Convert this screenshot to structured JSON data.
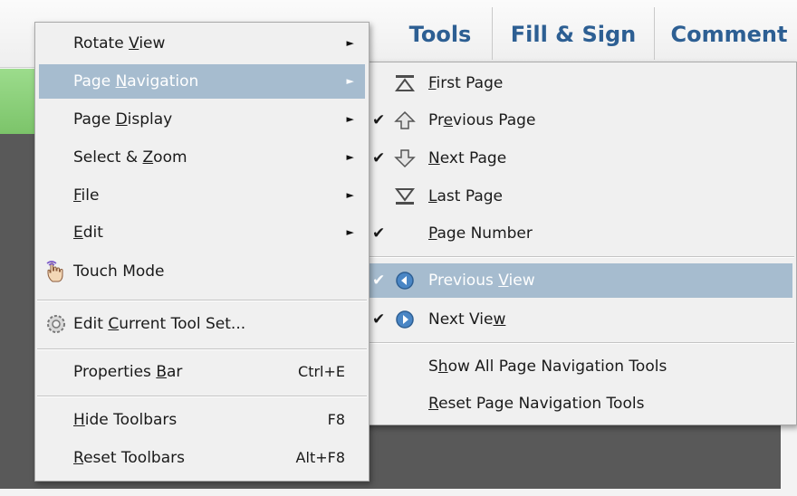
{
  "toolbar": {
    "tools": "Tools",
    "fill_sign": "Fill & Sign",
    "comment": "Comment"
  },
  "main_menu": {
    "rotate_view": {
      "pre": "Rotate ",
      "u": "V",
      "post": "iew"
    },
    "page_navigation": {
      "pre": "Page ",
      "u": "N",
      "post": "avigation"
    },
    "page_display": {
      "pre": "Page ",
      "u": "D",
      "post": "isplay"
    },
    "select_zoom": {
      "pre": "Select & ",
      "u": "Z",
      "post": "oom"
    },
    "file": {
      "pre": "",
      "u": "F",
      "post": "ile"
    },
    "edit": {
      "pre": "",
      "u": "E",
      "post": "dit"
    },
    "touch_mode": {
      "pre": "Touch Mode",
      "u": "",
      "post": ""
    },
    "edit_tool_set": {
      "pre": "Edit ",
      "u": "C",
      "post": "urrent Tool Set..."
    },
    "properties_bar": {
      "pre": "Properties ",
      "u": "B",
      "post": "ar",
      "shortcut": "Ctrl+E"
    },
    "hide_toolbars": {
      "pre": "",
      "u": "H",
      "post": "ide Toolbars",
      "shortcut": "F8"
    },
    "reset_toolbars": {
      "pre": "",
      "u": "R",
      "post": "eset Toolbars",
      "shortcut": "Alt+F8"
    }
  },
  "sub_menu": {
    "first_page": {
      "pre": "",
      "u": "F",
      "post": "irst Page",
      "checked": false,
      "icon": "first-page-icon"
    },
    "previous_page": {
      "pre": "Pr",
      "u": "e",
      "post": "vious Page",
      "checked": true,
      "icon": "up-arrow-icon"
    },
    "next_page": {
      "pre": "",
      "u": "N",
      "post": "ext Page",
      "checked": true,
      "icon": "down-arrow-icon"
    },
    "last_page": {
      "pre": "",
      "u": "L",
      "post": "ast Page",
      "checked": false,
      "icon": "last-page-icon"
    },
    "page_number": {
      "pre": "",
      "u": "P",
      "post": "age Number",
      "checked": true
    },
    "previous_view": {
      "pre": "Previous ",
      "u": "V",
      "post": "iew",
      "checked": true,
      "icon": "back-circle-icon"
    },
    "next_view": {
      "pre": "Next Vie",
      "u": "w",
      "post": "",
      "checked": true,
      "icon": "forward-circle-icon"
    },
    "show_all": {
      "pre": "S",
      "u": "h",
      "post": "ow All Page Navigation Tools"
    },
    "reset_nav": {
      "pre": "",
      "u": "R",
      "post": "eset Page Navigation Tools"
    },
    "check_glyph": "✔"
  },
  "submenu_arrow": "►",
  "colors": {
    "highlight": "#a6bccf",
    "toolbar_text": "#2d5f93",
    "dark_canvas": "#595959"
  }
}
